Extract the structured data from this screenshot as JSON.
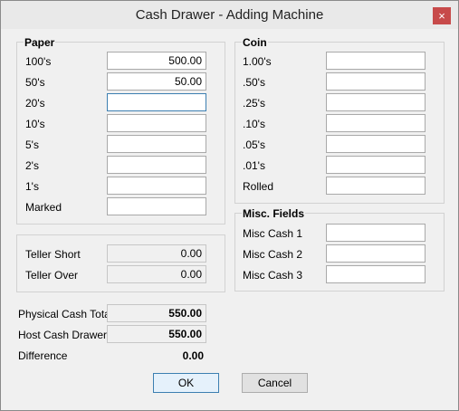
{
  "window": {
    "title": "Cash Drawer - Adding Machine",
    "close_glyph": "×"
  },
  "paper": {
    "legend": "Paper",
    "rows": [
      {
        "label": "100's",
        "value": "500.00"
      },
      {
        "label": "50's",
        "value": "50.00"
      },
      {
        "label": "20's",
        "value": ""
      },
      {
        "label": "10's",
        "value": ""
      },
      {
        "label": "5's",
        "value": ""
      },
      {
        "label": "2's",
        "value": ""
      },
      {
        "label": "1's",
        "value": ""
      },
      {
        "label": "Marked",
        "value": ""
      }
    ]
  },
  "coin": {
    "legend": "Coin",
    "rows": [
      {
        "label": "1.00's",
        "value": ""
      },
      {
        "label": ".50's",
        "value": ""
      },
      {
        "label": ".25's",
        "value": ""
      },
      {
        "label": ".10's",
        "value": ""
      },
      {
        "label": ".05's",
        "value": ""
      },
      {
        "label": ".01's",
        "value": ""
      },
      {
        "label": "Rolled",
        "value": ""
      }
    ]
  },
  "teller": {
    "rows": [
      {
        "label": "Teller Short",
        "value": "0.00"
      },
      {
        "label": "Teller Over",
        "value": "0.00"
      }
    ]
  },
  "misc": {
    "legend": "Misc. Fields",
    "rows": [
      {
        "label": "Misc Cash 1",
        "value": ""
      },
      {
        "label": "Misc Cash 2",
        "value": ""
      },
      {
        "label": "Misc Cash 3",
        "value": ""
      }
    ]
  },
  "totals": {
    "physical_label": "Physical Cash Total",
    "physical_value": "550.00",
    "host_label": "Host Cash Drawer",
    "host_value": "550.00",
    "difference_label": "Difference",
    "difference_value": "0.00"
  },
  "buttons": {
    "ok": "OK",
    "cancel": "Cancel"
  }
}
